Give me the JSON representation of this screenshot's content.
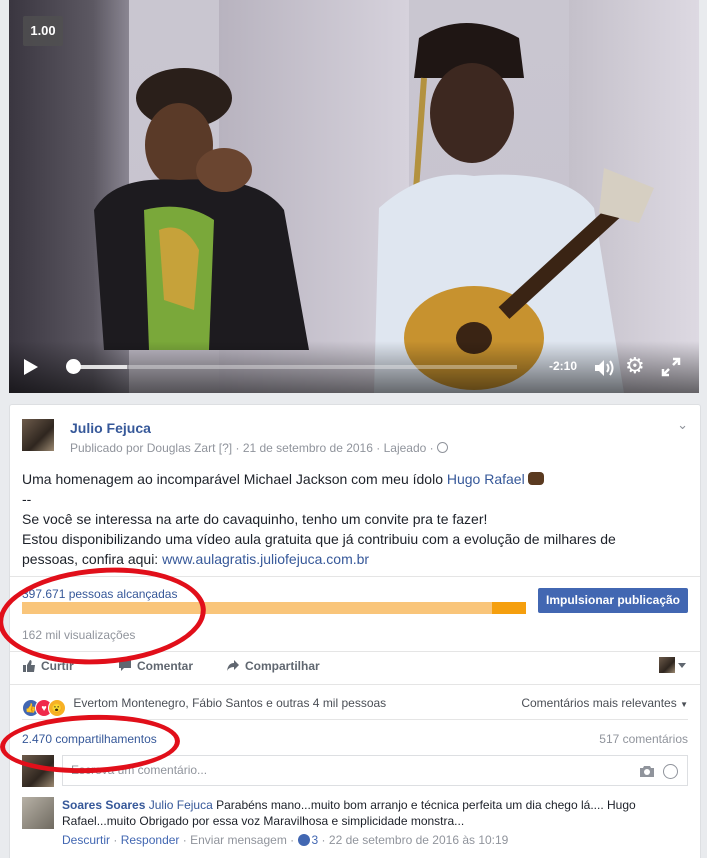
{
  "video": {
    "speed": "1.00",
    "time_remaining": "-2:10",
    "progress": 0.13
  },
  "post": {
    "page_name": "Julio Fejuca",
    "published_by_prefix": "Publicado por",
    "published_by": "Douglas Zart",
    "info_marker": "[?]",
    "date": "21 de setembro de 2016",
    "location": "Lajeado",
    "text_line1_prefix": "Uma homenagem ao incomparável Michael Jackson com meu ídolo",
    "text_line1_mention": "Hugo Rafael",
    "text_line2": "--",
    "text_line3": "Se você se interessa na arte do cavaquinho, tenho um convite pra te fazer!",
    "text_line4": "Estou disponibilizando uma vídeo aula gratuita que já contribuiu com a evolução de milhares de",
    "text_line5_prefix": "pessoas, confira aqui:",
    "text_line5_link": "www.aulagratis.juliofejuca.com.br"
  },
  "insights": {
    "reach": "397.671 pessoas alcançadas",
    "reach_fraction": 0.93,
    "boost_label": "Impulsionar publicação",
    "views": "162 mil visualizações"
  },
  "actions": {
    "like": "Curtir",
    "comment": "Comentar",
    "share": "Compartilhar"
  },
  "engagement": {
    "reactions_text": "Evertom Montenegro, Fábio Santos e outras 4 mil pessoas",
    "sort_label": "Comentários mais relevantes",
    "shares": "2.470 compartilhamentos",
    "comments": "517 comentários"
  },
  "composer": {
    "placeholder": "Escreva um comentário..."
  },
  "comment": {
    "author": "Soares Soares",
    "mention": "Julio Fejuca",
    "text": "Parabéns mano...muito bom arranjo e técnica perfeita um dia chego lá.... Hugo Rafael...muito Obrigado por essa voz Maravilhosa e simplicidade monstra...",
    "unlike": "Descurtir",
    "reply": "Responder",
    "message": "Enviar mensagem",
    "likes": "3",
    "timestamp": "22 de setembro de 2016 às 10:19",
    "dot": "·"
  },
  "colors": {
    "link": "#365899",
    "annotation_red": "#e10f1a",
    "boost_button": "#4267b2"
  }
}
